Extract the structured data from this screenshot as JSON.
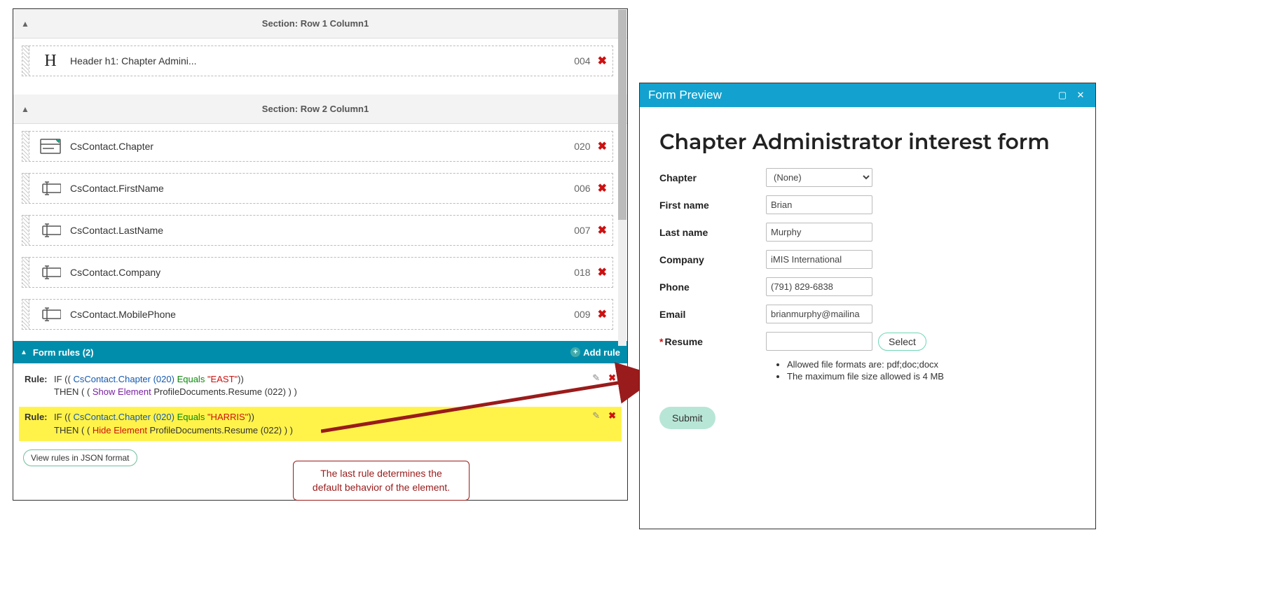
{
  "left": {
    "section1_title": "Section: Row 1 Column1",
    "section2_title": "Section: Row 2 Column1",
    "items1": [
      {
        "label": "Header h1: Chapter Admini...",
        "num": "004",
        "icon": "H"
      }
    ],
    "items2": [
      {
        "label": "CsContact.Chapter",
        "num": "020",
        "icon": "card"
      },
      {
        "label": "CsContact.FirstName",
        "num": "006",
        "icon": "text"
      },
      {
        "label": "CsContact.LastName",
        "num": "007",
        "icon": "text"
      },
      {
        "label": "CsContact.Company",
        "num": "018",
        "icon": "text"
      },
      {
        "label": "CsContact.MobilePhone",
        "num": "009",
        "icon": "text"
      }
    ],
    "rules_header": "Form rules (2)",
    "add_rule": "Add rule",
    "rules": [
      {
        "label": "Rule:",
        "if_prefix": "IF ((  ",
        "field": "CsContact.Chapter (020)",
        "op": " Equals ",
        "value": "\"EAST\"",
        "if_suffix": "))",
        "then_prefix": "THEN ( ( ",
        "action": "Show Element",
        "target": "   ProfileDocuments.Resume (022) ) )",
        "highlight": false,
        "action_class": "tok-show"
      },
      {
        "label": "Rule:",
        "if_prefix": "IF ((  ",
        "field": "CsContact.Chapter (020)",
        "op": " Equals ",
        "value": "\"HARRIS\"",
        "if_suffix": "))",
        "then_prefix": "THEN ( ( ",
        "action": "Hide Element",
        "target": "   ProfileDocuments.Resume (022) ) )",
        "highlight": true,
        "action_class": "tok-hide"
      }
    ],
    "json_btn": "View rules in JSON format"
  },
  "callout": {
    "line1": "The last rule determines the",
    "line2": "default behavior of the element."
  },
  "preview": {
    "title": "Form Preview",
    "heading": "Chapter Administrator interest form",
    "fields": {
      "chapter_label": "Chapter",
      "chapter_value": "(None)",
      "fname_label": "First name",
      "fname_value": "Brian",
      "lname_label": "Last name",
      "lname_value": "Murphy",
      "company_label": "Company",
      "company_value": "iMIS International",
      "phone_label": "Phone",
      "phone_value": "(791) 829-6838",
      "email_label": "Email",
      "email_value": "brianmurphy@mailina",
      "resume_label": "Resume",
      "select_btn": "Select",
      "bullet1": "Allowed file formats are: pdf;doc;docx",
      "bullet2": "The maximum file size allowed is 4 MB",
      "submit": "Submit"
    }
  }
}
